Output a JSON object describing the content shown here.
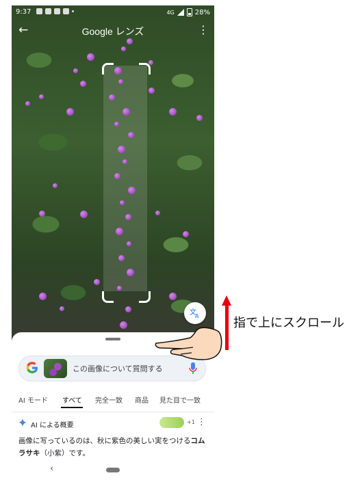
{
  "status_bar": {
    "time": "9:37",
    "network": "4G",
    "battery": "28%"
  },
  "lens": {
    "title": "Google レンズ",
    "search_placeholder": "この画像について質問する"
  },
  "tabs": [
    {
      "label": "AI モード"
    },
    {
      "label": "すべて"
    },
    {
      "label": "完全一致"
    },
    {
      "label": "商品"
    },
    {
      "label": "見た目で一致"
    }
  ],
  "active_tab_index": 1,
  "ai_overview": {
    "label": "AI による概要",
    "sources_count": "+1",
    "text_prefix": "画像に写っているのは、秋に紫色の美しい実をつける",
    "text_bold": "コムラサキ",
    "text_suffix": "（小紫）です。"
  },
  "annotation": {
    "text": "指で上にスクロール"
  },
  "colors": {
    "arrow": "#e60012",
    "berry": "#a24cc4",
    "google_blue": "#4285f4",
    "google_red": "#ea4335",
    "google_yellow": "#fbbc05",
    "google_green": "#34a853"
  },
  "icons": [
    "back-arrow-icon",
    "more-vert-icon",
    "translate-icon",
    "google-g-icon",
    "mic-icon",
    "ai-sparkle-icon",
    "nav-back-icon",
    "nav-home-icon"
  ]
}
